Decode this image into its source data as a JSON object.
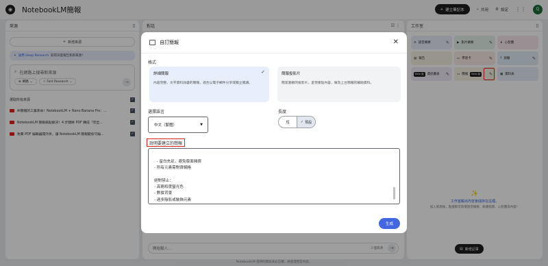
{
  "app": {
    "title": "NotebookLM簡報",
    "logo": "notebooklm-logo-icon"
  },
  "topbar": {
    "new_notebook": "建立筆記本",
    "share": "共用",
    "settings": "設定",
    "avatar": "Q"
  },
  "sources": {
    "title": "來源",
    "add_label": "新增來源",
    "deep_research_link": "試用 Deep Research",
    "deep_research_text": "取得深度報告和新來源！",
    "search_placeholder": "在網路上搜尋新來源",
    "chip_web": "網路",
    "chip_research": "Fast Research",
    "select_all": "選取所有來源",
    "items": [
      {
        "title": "AI簡報的工業革命！NotebookLM + Nano Banana Pro：..."
      },
      {
        "title": "NotebookLM 簡報痛點解決！4 步驟將 PDF 轉成「完全..."
      },
      {
        "title": "免費 PDF 編輯器開外掛，讓 NotebookLM 簡報變身可編..."
      }
    ]
  },
  "chat": {
    "title": "對話",
    "input_placeholder": "開始輸入...",
    "source_count": "3 個來源"
  },
  "studio": {
    "title": "工作室",
    "tiles": [
      {
        "label": "語音摘要",
        "bg": "#ebeef9"
      },
      {
        "label": "影片摘要",
        "bg": "#e6f2ea"
      },
      {
        "label": "心智圖",
        "bg": "#f8e9ef"
      },
      {
        "label": "報告",
        "bg": "#f6f1e3"
      },
      {
        "label": "學習卡",
        "bg": "#f9ece7"
      },
      {
        "label": "測驗",
        "bg": "#e3eef7"
      },
      {
        "label": "資訊圖表",
        "bg": "#f0ebf7",
        "badge": "Beta 版"
      },
      {
        "label": "簡報",
        "bg": "#f6f1e3",
        "badge": "Beta 版"
      },
      {
        "label": "資料表",
        "bg": "#ebeef9"
      }
    ],
    "empty_title": "工作室輸出內容會儲存在這裡。",
    "empty_desc": "加入來源後，點選即可新增語音摘要、研讀指南、心智圖等內容！",
    "add_note": "新增記事"
  },
  "footer": "NotebookLM 提供的資訊未必正確，請查證回答內容。",
  "modal": {
    "title": "自訂簡報",
    "format_label": "格式",
    "formats": [
      {
        "title": "詳細簡報",
        "desc": "內容完整、文字資料詳盡的簡報，適合以電子郵件分享或獨立閱讀。",
        "selected": true
      },
      {
        "title": "簡報投影片",
        "desc": "簡潔美觀的投影片，呈現重點內容，做為上台簡報的輔助資料。",
        "selected": false
      }
    ],
    "language_label": "選擇語言",
    "language_value": "中文（繁體）",
    "length_label": "長度",
    "length_options": [
      {
        "label": "短",
        "selected": false
      },
      {
        "label": "預設",
        "selected": true
      }
    ],
    "description_label": "說明要建立的簡報",
    "description_text": "- 留白充足，避免版面擁擠\n- 所有元素需對齊網格\n\n絕對禁止：\n- 高飽和度螢光色\n- 數據背景\n- 過多陰影或裝飾元素",
    "generate_label": "生成"
  }
}
